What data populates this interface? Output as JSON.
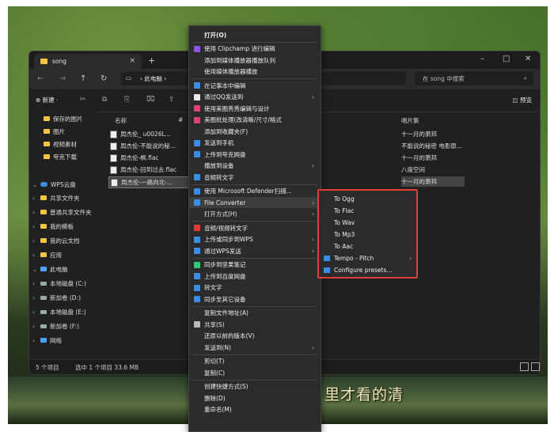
{
  "wallpaper": {
    "subtitle": "里才看的清"
  },
  "window": {
    "tab_title": "song",
    "close_tab": "×",
    "new_tab": "+",
    "controls": {
      "min": "–",
      "max": "□",
      "close": "✕"
    },
    "address": {
      "pc_icon": "▭",
      "sep": "›",
      "crumb": "此电脑",
      "more": "›"
    },
    "search_placeholder": "在 song 中搜索",
    "toolbar": {
      "new_label": "⊕ 新建 ·",
      "preview_label": "◫ 预览"
    },
    "sidebar": [
      {
        "label": "保存的图片",
        "kind": "folder"
      },
      {
        "label": "图片",
        "kind": "folder"
      },
      {
        "label": "视频素材",
        "kind": "folder"
      },
      {
        "label": "夸克下载",
        "kind": "folder"
      },
      {
        "label": "WPS云盘",
        "kind": "cloud",
        "chev": "⌄"
      },
      {
        "label": "共享文件夹",
        "kind": "folder",
        "chev": "›"
      },
      {
        "label": "普通共享文件夹",
        "kind": "folder",
        "chev": "›"
      },
      {
        "label": "我的模板",
        "kind": "folder",
        "chev": "›"
      },
      {
        "label": "我的云文档",
        "kind": "folder",
        "chev": "›"
      },
      {
        "label": "应用",
        "kind": "folder",
        "chev": "›"
      },
      {
        "label": "此电脑",
        "kind": "pc",
        "chev": "⌄"
      },
      {
        "label": "本地磁盘 (C:)",
        "kind": "drive",
        "chev": "›"
      },
      {
        "label": "新加卷 (D:)",
        "kind": "drive",
        "chev": "›"
      },
      {
        "label": "本地磁盘 (E:)",
        "kind": "drive",
        "chev": "›"
      },
      {
        "label": "新加卷 (F:)",
        "kind": "drive",
        "chev": "›"
      },
      {
        "label": "网络",
        "kind": "pc",
        "chev": "›"
      }
    ],
    "columns": {
      "name": "名称",
      "num": "#",
      "album": "唱片集"
    },
    "files": [
      {
        "name": "周杰伦_ u0026L...",
        "album": "十一月的萧邦"
      },
      {
        "name": "周杰伦-不能说的秘...",
        "album": "不能说的秘密 电影原..."
      },
      {
        "name": "周杰伦-枫.flac",
        "album": "十一月的萧邦"
      },
      {
        "name": "周杰伦-回到过去.flac",
        "album": "八度空间"
      },
      {
        "name": "周杰伦-一路向北-...",
        "album": "十一月的萧邦"
      }
    ],
    "status": {
      "count": "5 个项目",
      "sel": "选中 1 个项目  33.6 MB"
    }
  },
  "context_menu": [
    {
      "label": "打开(O)",
      "bold": true
    },
    {
      "label": "使用 Clipchamp 进行编辑",
      "icon_color": "#8a55e6"
    },
    {
      "label": "添加到媒体播放器播放队列"
    },
    {
      "label": "使用媒体播放器播放"
    },
    {
      "label": "在记事本中编辑",
      "icon_color": "#3a8ee6"
    },
    {
      "label": "通过QQ发送到",
      "icon_color": "#e9e9e9",
      "arrow": true
    },
    {
      "label": "使用美图秀秀编辑与设计",
      "icon_color": "#e0407a"
    },
    {
      "label": "美图批处理(改清晰/尺寸/格式",
      "icon_color": "#e0407a"
    },
    {
      "label": "添加到收藏夹(F)"
    },
    {
      "label": "发送到手机",
      "icon_color": "#3a8ee6"
    },
    {
      "label": "上传到夸克网盘",
      "icon_color": "#3a8ee6"
    },
    {
      "label": "播放到设备",
      "arrow": true
    },
    {
      "label": "音频转文字",
      "icon_color": "#3a8ee6"
    },
    {
      "label": "使用 Microsoft Defender扫描...",
      "icon_color": "#3a8ee6"
    },
    {
      "label": "File Converter",
      "icon_color": "#3a8ee6",
      "arrow": true,
      "highlight": true
    },
    {
      "label": "打开方式(H)",
      "arrow": true
    },
    {
      "label": "音频/视频转文字",
      "icon_color": "#e03c3c"
    },
    {
      "label": "上传或同步到WPS",
      "icon_color": "#3a8ee6",
      "arrow": true
    },
    {
      "label": "通过WPS发送",
      "icon_color": "#3a8ee6",
      "arrow": true
    },
    {
      "label": "同步到坚果笔记",
      "icon_color": "#2ecc71"
    },
    {
      "label": "上传到百度网盘",
      "icon_color": "#3a8ee6"
    },
    {
      "label": "转文字",
      "icon_color": "#3a8ee6"
    },
    {
      "label": "同步至其它设备",
      "icon_color": "#3a8ee6"
    },
    {
      "label": "复制文件地址(A)"
    },
    {
      "label": "共享(S)",
      "icon_color": "#bbbbbb"
    },
    {
      "label": "还原以前的版本(V)"
    },
    {
      "label": "发送到(N)",
      "arrow": true
    },
    {
      "label": "剪切(T)"
    },
    {
      "label": "复制(C)"
    },
    {
      "label": "创建快捷方式(S)"
    },
    {
      "label": "删除(D)"
    },
    {
      "label": "重命名(M)"
    }
  ],
  "submenu": [
    {
      "label": "To Ogg"
    },
    {
      "label": "To Flac"
    },
    {
      "label": "To Wav"
    },
    {
      "label": "To Mp3"
    },
    {
      "label": "To Aac"
    },
    {
      "label": "Tempo - Pitch",
      "arrow": true,
      "icon_color": "#3a8ee6"
    },
    {
      "label": "Configure presets...",
      "icon_color": "#3a8ee6"
    }
  ],
  "glyphs": {
    "arrow": "›",
    "cut": "✂",
    "copy": "⧉",
    "paste": "⎘",
    "rename": "⌧",
    "share": "⇪",
    "search": "⌕",
    "back": "←",
    "forward": "→",
    "up": "↑",
    "refresh": "↻"
  }
}
